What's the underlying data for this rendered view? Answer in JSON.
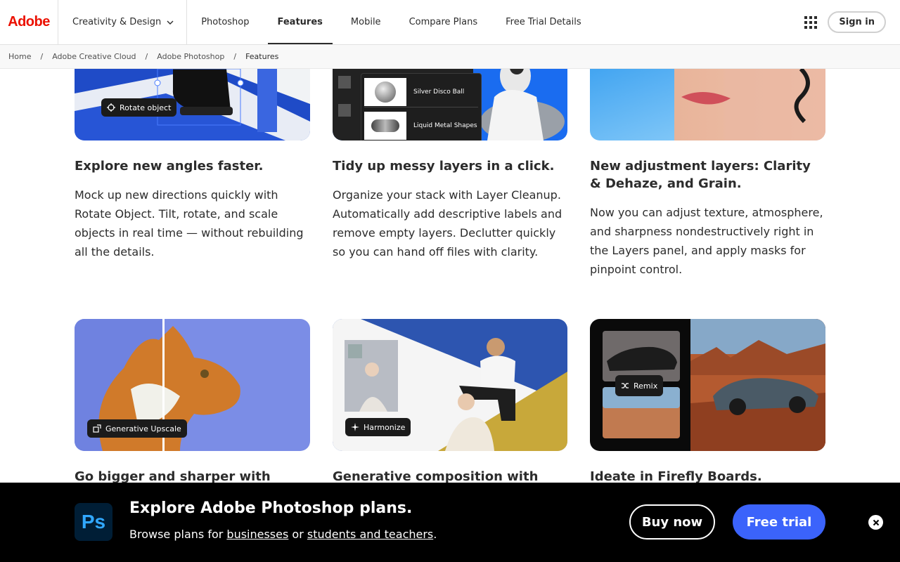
{
  "brand": {
    "logo_text": "Adobe",
    "color": "#eb1000"
  },
  "nav": {
    "category": "Creativity & Design",
    "links": [
      "Photoshop",
      "Features",
      "Mobile",
      "Compare Plans",
      "Free Trial Details"
    ],
    "active": "Features",
    "apps_icon": "apps-grid-icon",
    "signin": "Sign in"
  },
  "breadcrumb": [
    "Home",
    "Adobe Creative Cloud",
    "Adobe Photoshop",
    "Features"
  ],
  "cards_row1": [
    {
      "title": "Explore new angles faster.",
      "body": "Mock up new directions quickly with Rotate Object. Tilt, rotate, and scale objects in real time — without rebuilding all the details.",
      "badge": "Rotate object"
    },
    {
      "title": "Tidy up messy layers in a click.",
      "body": "Organize your stack with Layer Cleanup. Automatically add descriptive labels and remove empty layers. Declutter quickly so you can hand off files with clarity.",
      "layers": [
        "Silver Disco Ball",
        "Liquid Metal Shapes"
      ]
    },
    {
      "title": "New adjustment layers: Clarity & Dehaze, and Grain.",
      "body": "Now you can adjust texture, atmosphere, and sharpness nondestructively right in the Layers panel, and apply masks for pinpoint control."
    }
  ],
  "cards_row2": [
    {
      "title": "Go bigger and sharper with Topaz",
      "badge": "Generative Upscale"
    },
    {
      "title": "Generative composition with",
      "badge": "Harmonize"
    },
    {
      "title": "Ideate in Firefly Boards.",
      "badge": "Remix"
    }
  ],
  "promo": {
    "title": "Explore Adobe Photoshop plans.",
    "sub_prefix": "Browse plans for ",
    "link1": "businesses",
    "sub_mid": " or ",
    "link2": "students and teachers",
    "sub_suffix": ".",
    "buy": "Buy now",
    "trial": "Free trial",
    "ps_logo": "Ps",
    "accent": "#3b63fb"
  }
}
